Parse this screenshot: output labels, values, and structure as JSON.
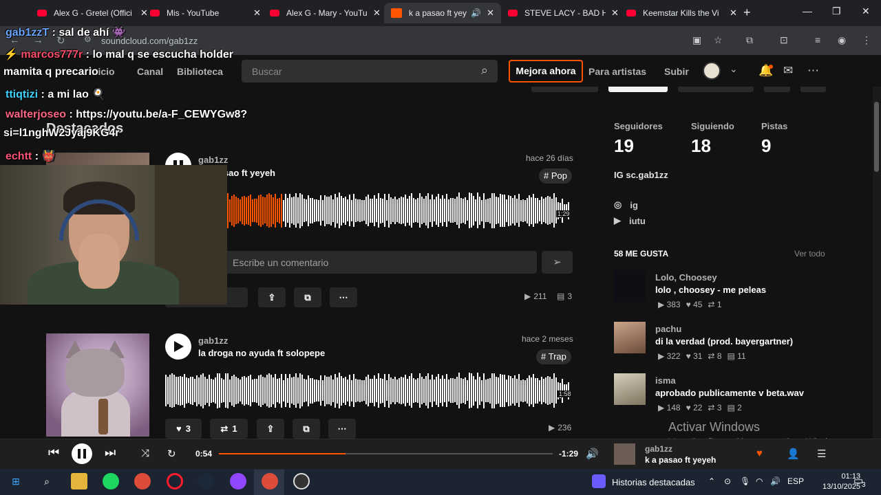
{
  "browser": {
    "tabs": [
      {
        "title": "Alex G - Gretel (Offici",
        "kind": "youtube"
      },
      {
        "title": "Mis - YouTube",
        "kind": "youtube"
      },
      {
        "title": "Alex G - Mary - YouTu",
        "kind": "youtube"
      },
      {
        "title": "k a pasao ft yeyeh",
        "kind": "soundcloud",
        "active": true
      },
      {
        "title": "STEVE LACY - BAD HA",
        "kind": "youtube"
      },
      {
        "title": "Keemstar Kills the Vi",
        "kind": "youtube"
      }
    ],
    "url": "soundcloud.com/gab1zz"
  },
  "header": {
    "nav": [
      "Inicio",
      "Canal",
      "Biblioteca"
    ],
    "search_placeholder": "Buscar",
    "upgrade": "Mejora ahora",
    "for_artists": "Para artistas",
    "upload": "Subir"
  },
  "feed": {
    "section_title": "Destacados",
    "tracks": [
      {
        "uploader": "gab1zz",
        "title": "k a pasao ft yeyeh",
        "when": "hace 26 días",
        "tag": "# Pop",
        "duration": "1:29",
        "progress": 0.29,
        "comment_placeholder": "Escribe un comentario",
        "likes": "2",
        "plays": "211",
        "comments": "3"
      },
      {
        "uploader": "gab1zz",
        "title": "la droga no ayuda ft solopepe",
        "when": "hace 2 meses",
        "tag": "# Trap",
        "duration": "1:58",
        "likes": "3",
        "reposts": "1",
        "plays": "236"
      }
    ]
  },
  "profile": {
    "stats": [
      {
        "label": "Seguidores",
        "value": "19"
      },
      {
        "label": "Siguiendo",
        "value": "18"
      },
      {
        "label": "Pistas",
        "value": "9"
      }
    ],
    "bio": "IG sc.gab1zz",
    "links": [
      {
        "icon": "instagram-icon",
        "label": "ig"
      },
      {
        "icon": "youtube-icon",
        "label": "iutu"
      }
    ],
    "likes_title": "58 ME GUSTA",
    "see_all": "Ver todo",
    "liked": [
      {
        "user": "Lolo, Choosey",
        "title": "lolo , choosey - me peleas",
        "plays": "383",
        "likes": "45",
        "reposts": "1",
        "comments": ""
      },
      {
        "user": "pachu",
        "title": "di la verdad (prod. bayergartner)",
        "plays": "322",
        "likes": "31",
        "reposts": "8",
        "comments": "11"
      },
      {
        "user": "isma",
        "title": "aprobado publicamente v beta.wav",
        "plays": "148",
        "likes": "22",
        "reposts": "3",
        "comments": "2"
      }
    ]
  },
  "player": {
    "elapsed": "0:54",
    "remaining": "-1:29",
    "progress": 0.38,
    "uploader": "gab1zz",
    "title": "k a pasao ft yeyeh"
  },
  "windows": {
    "activate_title": "Activar Windows",
    "activate_sub": "Ve a Configuración para activar Windows.",
    "taskbar_text": "Historias destacadas",
    "lang": "ESP",
    "time": "01:13",
    "date": "13/10/2025",
    "notif_count": "3"
  },
  "overlay_chat": [
    {
      "user": "gab1zzT",
      "msg": ": sal de ahí",
      "emote": "👾"
    },
    {
      "user": "marcos777r",
      "msg": ": lo mal q se escucha holder",
      "emote": ""
    },
    {
      "user": "",
      "msg": "mamita q precario",
      "emote": ""
    },
    {
      "user": "ttiqtizi",
      "msg": ": a mi lao",
      "emote": "🍳"
    },
    {
      "user": "walterjoseo",
      "msg": ": https://youtu.be/a-F_CEWYGw8?",
      "emote": ""
    },
    {
      "user": "",
      "msg": "si=l1nghW2Jyaj9KG4r",
      "emote": ""
    },
    {
      "user": "echtt",
      "msg": ":",
      "emote": "👹"
    }
  ],
  "colors": {
    "accent": "#ff5500",
    "bg": "#121212",
    "wave_played": "#ff5500",
    "wave_unplayed": "#ffffff"
  }
}
